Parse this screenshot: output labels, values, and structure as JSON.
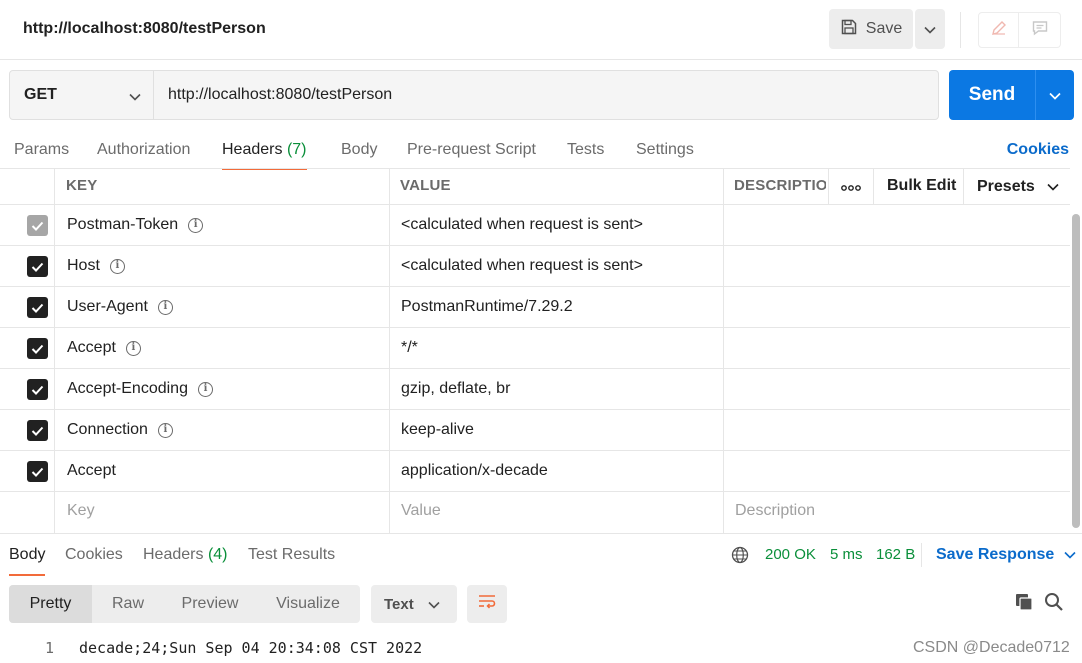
{
  "header": {
    "title": "http://localhost:8080/testPerson",
    "save_label": "Save"
  },
  "request": {
    "method": "GET",
    "url": "http://localhost:8080/testPerson",
    "send_label": "Send"
  },
  "request_tabs": [
    {
      "label": "Params",
      "count": ""
    },
    {
      "label": "Authorization",
      "count": ""
    },
    {
      "label": "Headers",
      "count": "(7)"
    },
    {
      "label": "Body",
      "count": ""
    },
    {
      "label": "Pre-request Script",
      "count": ""
    },
    {
      "label": "Tests",
      "count": ""
    },
    {
      "label": "Settings",
      "count": ""
    }
  ],
  "active_request_tab": "Headers",
  "cookies_link": "Cookies",
  "headers_table": {
    "columns": [
      "KEY",
      "VALUE",
      "DESCRIPTIO"
    ],
    "bulk_edit": "Bulk Edit",
    "presets": "Presets",
    "rows": [
      {
        "key": "Postman-Token",
        "value": "<calculated when request is sent>",
        "checked": true,
        "disabled": true,
        "info": true
      },
      {
        "key": "Host",
        "value": "<calculated when request is sent>",
        "checked": true,
        "disabled": false,
        "info": true
      },
      {
        "key": "User-Agent",
        "value": "PostmanRuntime/7.29.2",
        "checked": true,
        "disabled": false,
        "info": true
      },
      {
        "key": "Accept",
        "value": "*/*",
        "checked": true,
        "disabled": false,
        "info": true
      },
      {
        "key": "Accept-Encoding",
        "value": "gzip, deflate, br",
        "checked": true,
        "disabled": false,
        "info": true
      },
      {
        "key": "Connection",
        "value": "keep-alive",
        "checked": true,
        "disabled": false,
        "info": true
      },
      {
        "key": "Accept",
        "value": "application/x-decade",
        "checked": true,
        "disabled": false,
        "info": false
      }
    ],
    "placeholders": {
      "key": "Key",
      "value": "Value",
      "description": "Description"
    }
  },
  "response": {
    "tabs": [
      {
        "label": "Body",
        "count": ""
      },
      {
        "label": "Cookies",
        "count": ""
      },
      {
        "label": "Headers",
        "count": "(4)"
      },
      {
        "label": "Test Results",
        "count": ""
      }
    ],
    "active_tab": "Body",
    "status": "200 OK",
    "time": "5 ms",
    "size": "162 B",
    "save_response": "Save Response",
    "view_modes": [
      "Pretty",
      "Raw",
      "Preview",
      "Visualize"
    ],
    "active_view": "Pretty",
    "format": "Text",
    "lines": [
      {
        "num": "1",
        "text": "decade;24;Sun Sep 04 20:34:08 CST 2022"
      }
    ]
  },
  "watermark": "CSDN @Decade0712",
  "colors": {
    "accent_blue": "#0b78e3",
    "link_blue": "#0b6bcb",
    "status_green": "#0a8f3a",
    "tab_underline": "#f26b3a"
  },
  "icons": [
    "save-icon",
    "chevron-down-icon",
    "pencil-icon",
    "comment-icon",
    "info-icon",
    "more-horizontal-icon",
    "globe-icon",
    "wrap-lines-icon",
    "copy-icon",
    "search-icon",
    "checkmark-icon"
  ]
}
